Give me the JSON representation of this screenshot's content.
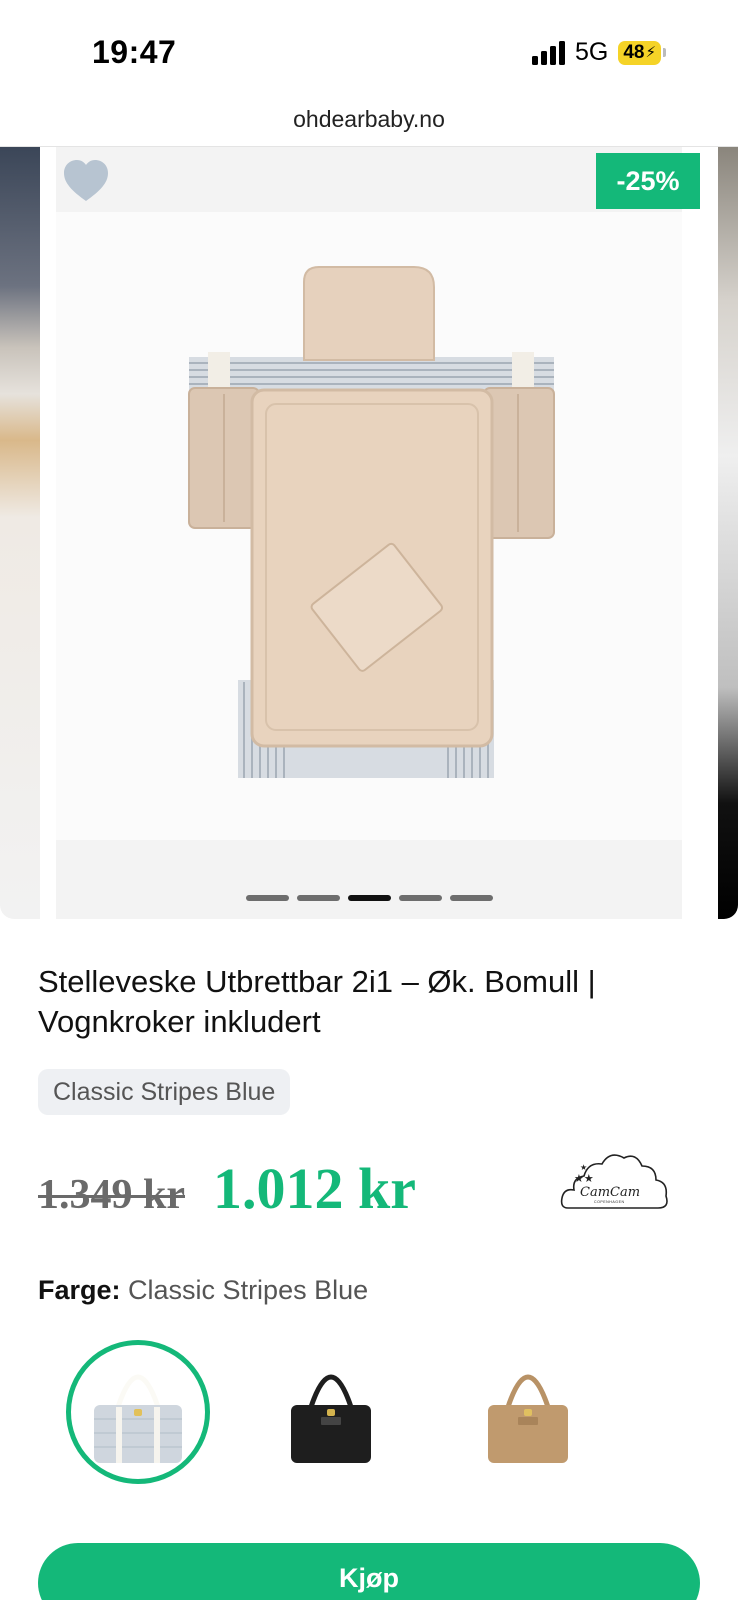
{
  "status_bar": {
    "time": "19:47",
    "network": "5G",
    "battery": "48"
  },
  "browser": {
    "url": "ohdearbaby.no"
  },
  "carousel": {
    "discount_badge": "-25%",
    "slide_count": 5,
    "active_slide": 3
  },
  "product": {
    "title": "Stelleveske Utbrettbar 2i1 – Øk. Bomull | Vognkroker inkludert",
    "variant_chip": "Classic Stripes Blue",
    "old_price": "1.349 kr",
    "new_price": "1.012 kr",
    "brand_logo_text": "CamCam",
    "brand_logo_subtext": "COPENHAGEN"
  },
  "color_selector": {
    "label": "Farge:",
    "selected_value": "Classic Stripes Blue",
    "options": [
      {
        "name": "Classic Stripes Blue",
        "color": "#cfd6de",
        "selected": true
      },
      {
        "name": "Black",
        "color": "#1e1e1e",
        "selected": false
      },
      {
        "name": "Camel",
        "color": "#c09a6e",
        "selected": false
      }
    ]
  },
  "actions": {
    "buy_label": "Kjøp"
  },
  "colors": {
    "accent": "#14b879",
    "old_price": "#6a6a6a",
    "chip_bg": "#eef0f3"
  }
}
